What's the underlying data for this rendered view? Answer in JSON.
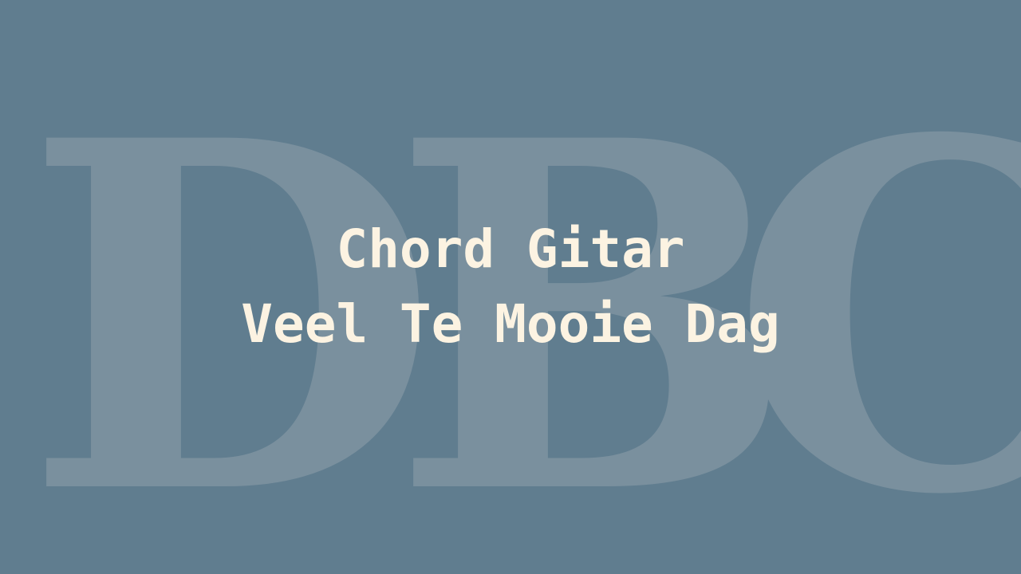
{
  "watermark": {
    "letters": [
      "D",
      "B",
      "C"
    ]
  },
  "title": {
    "line1": "Chord Gitar",
    "line2": "Veel Te Mooie Dag"
  },
  "colors": {
    "background": "#607d8f",
    "watermark": "#7a909e",
    "title_text": "#fcf3e2"
  }
}
